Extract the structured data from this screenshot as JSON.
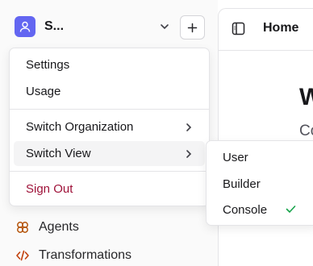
{
  "org": {
    "name": "Surya's Organization",
    "avatar_color": "#6366f1"
  },
  "main": {
    "page_title": "Home",
    "heading": "W",
    "subheading": "Co"
  },
  "sidebar": {
    "items": [
      {
        "label": "Agents",
        "icon": "brain-icon",
        "icon_color": "#b45309"
      },
      {
        "label": "Transformations",
        "icon": "code-icon",
        "icon_color": "#c2410c"
      }
    ]
  },
  "org_menu": {
    "settings": "Settings",
    "usage": "Usage",
    "switch_organization": "Switch Organization",
    "switch_view": "Switch View",
    "sign_out": "Sign Out"
  },
  "view_submenu": {
    "options": [
      "User",
      "Builder",
      "Console"
    ],
    "selected": "Console"
  },
  "colors": {
    "accent": "#6366f1",
    "danger": "#9f1239",
    "check": "#16a34a"
  }
}
